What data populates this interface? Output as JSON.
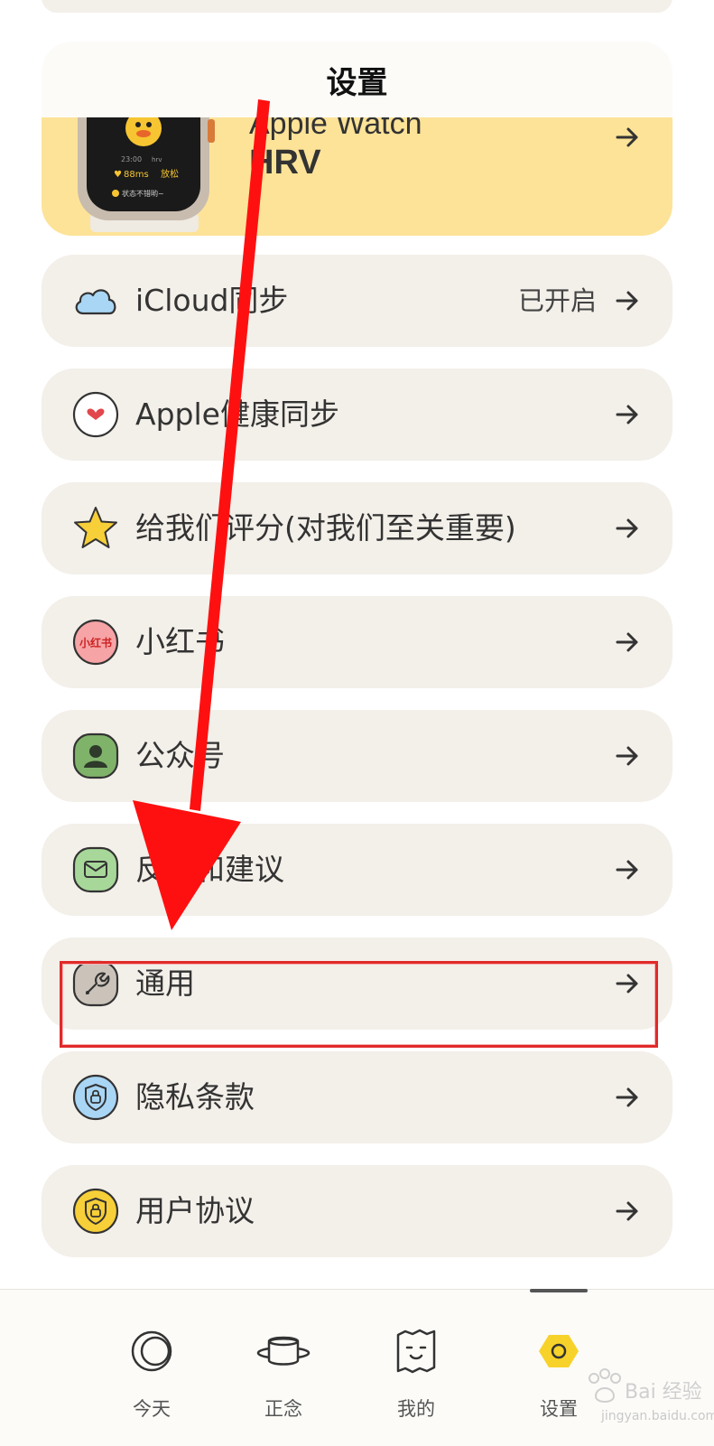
{
  "header": {
    "title": "设置"
  },
  "watch_card": {
    "line1": "Apple Watch",
    "line2": "HRV",
    "watch_screen": {
      "time": "23:00",
      "tag": "hrv",
      "value": "88ms",
      "state": "放松",
      "status": "状态不错哟~"
    }
  },
  "settings": [
    {
      "label": "iCloud同步",
      "status": "已开启",
      "icon": "cloud-icon"
    },
    {
      "label": "Apple健康同步",
      "status": "",
      "icon": "heart-icon"
    },
    {
      "label": "给我们评分(对我们至关重要)",
      "status": "",
      "icon": "star-icon"
    },
    {
      "label": "小红书",
      "status": "",
      "icon": "xiaohongshu-icon",
      "icon_text": "小红书"
    },
    {
      "label": "公众号",
      "status": "",
      "icon": "person-icon"
    },
    {
      "label": "反馈和建议",
      "status": "",
      "icon": "mail-icon"
    },
    {
      "label": "通用",
      "status": "",
      "icon": "wrench-icon"
    },
    {
      "label": "隐私条款",
      "status": "",
      "icon": "lock-shield-icon"
    },
    {
      "label": "用户协议",
      "status": "",
      "icon": "lock-shield-icon"
    }
  ],
  "tabbar": [
    {
      "label": "今天",
      "icon": "moon-icon"
    },
    {
      "label": "正念",
      "icon": "bowl-icon"
    },
    {
      "label": "我的",
      "icon": "face-icon"
    },
    {
      "label": "设置",
      "icon": "hexagon-icon",
      "active": true
    }
  ],
  "watermark": {
    "text": "jingyan.baidu.com",
    "logo_text": "Bai 经验"
  },
  "colors": {
    "accent_yellow": "#fde398",
    "row_bg": "#f3efe9",
    "highlight_red": "#e12a2a",
    "annotation_arrow": "#ff1010",
    "active_tab": "#f7d22a"
  }
}
